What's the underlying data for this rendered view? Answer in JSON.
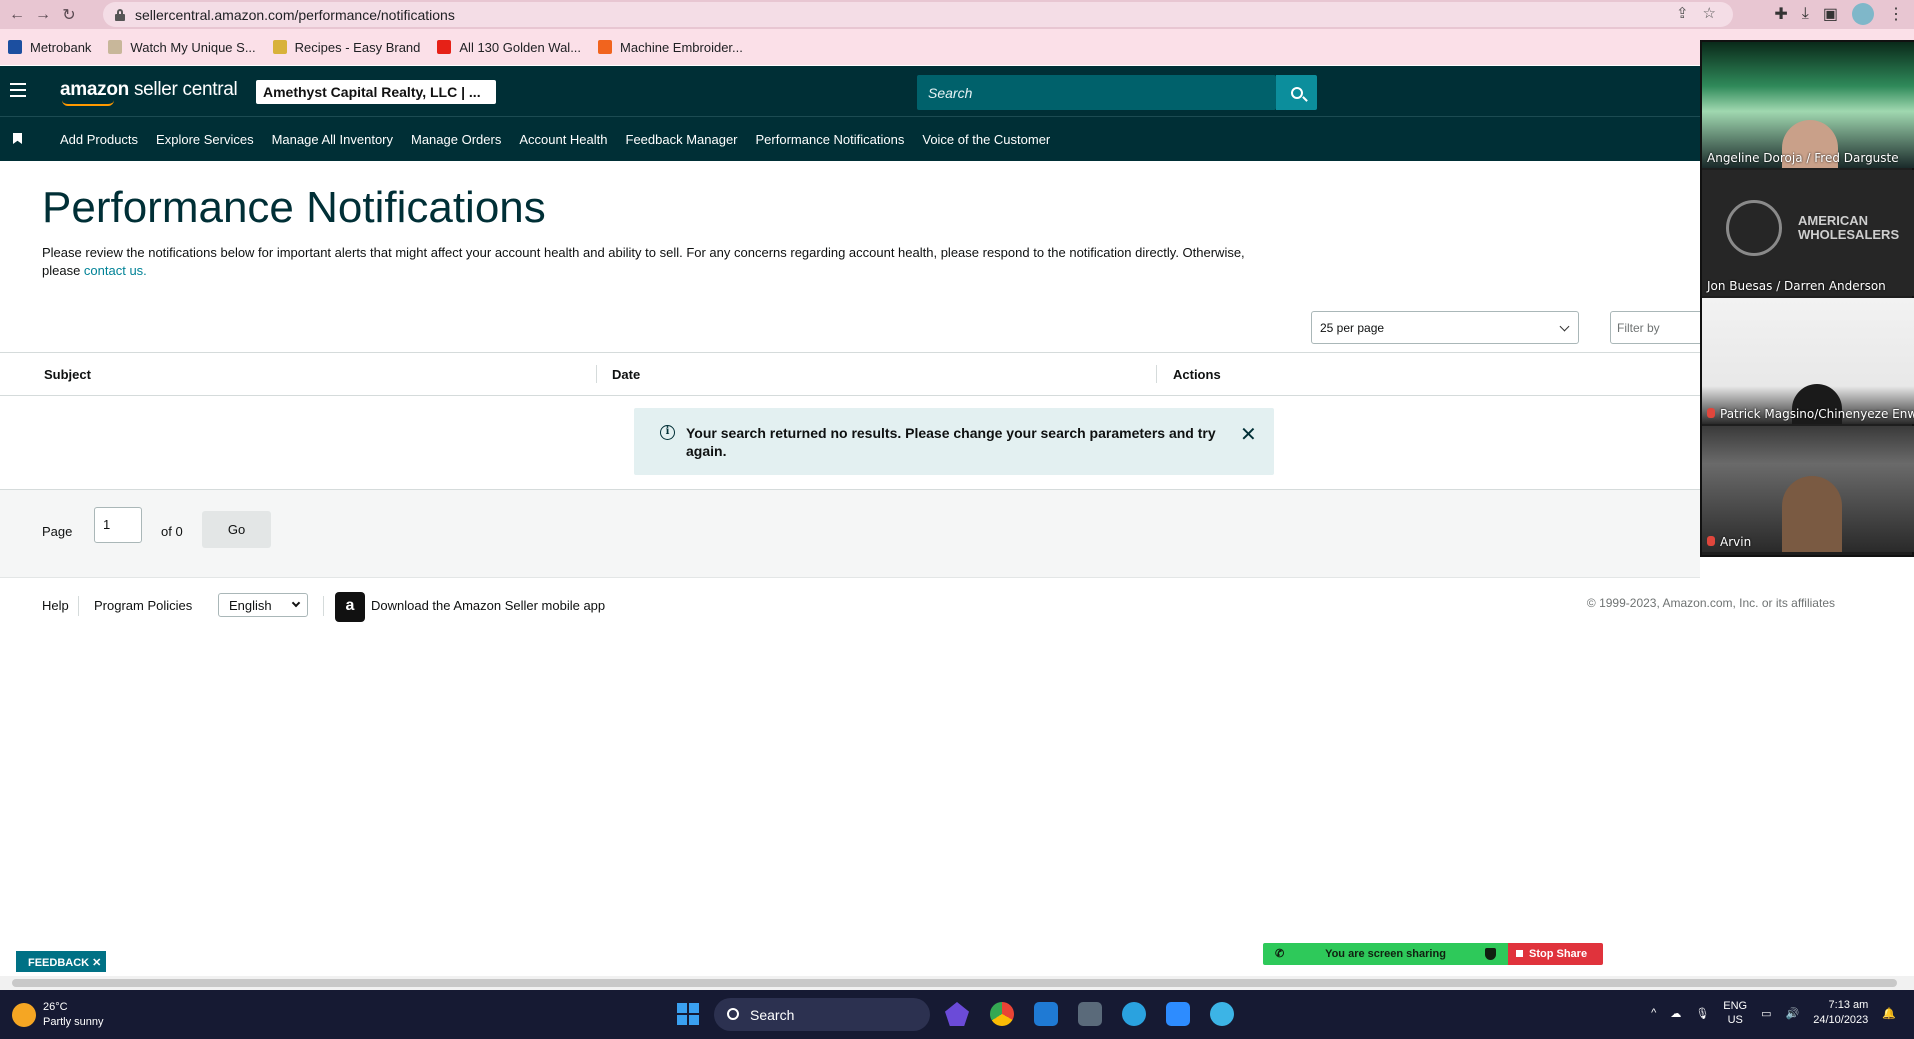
{
  "browser": {
    "url": "sellercentral.amazon.com/performance/notifications",
    "bookmarks": [
      {
        "label": "Metrobank",
        "color": "#1c4fa0"
      },
      {
        "label": "Watch My Unique S...",
        "color": "#c8b79a"
      },
      {
        "label": "Recipes - Easy Brand",
        "color": "#d8b23a"
      },
      {
        "label": "All 130 Golden Wal...",
        "color": "#e62117"
      },
      {
        "label": "Machine Embroider...",
        "color": "#f1641e"
      }
    ]
  },
  "header": {
    "logo_main": "amazon",
    "logo_sub": "seller central",
    "account": "Amethyst Capital Realty, LLC | ...",
    "search_placeholder": "Search"
  },
  "nav": {
    "items": [
      "Add Products",
      "Explore Services",
      "Manage All Inventory",
      "Manage Orders",
      "Account Health",
      "Feedback Manager",
      "Performance Notifications",
      "Voice of the Customer"
    ]
  },
  "main": {
    "title": "Performance Notifications",
    "description": "Please review the notifications below for important alerts that might affect your account health and ability to sell. For any concerns regarding account health, please respond to the notification directly. Otherwise, please ",
    "contact_link": "contact us.",
    "per_page": "25 per page",
    "filter_placeholder": "Filter by",
    "columns": [
      "Subject",
      "Date",
      "Actions"
    ],
    "alert_message": "Your search returned no results. Please change your search parameters and try again.",
    "pager": {
      "page_label": "Page",
      "page_value": "1",
      "of_label": "of 0",
      "go_label": "Go"
    }
  },
  "footer": {
    "help": "Help",
    "policies": "Program Policies",
    "language": "English",
    "app_link": "Download the Amazon Seller mobile app",
    "copyright": "© 1999-2023, Amazon.com, Inc. or its affiliates"
  },
  "video": {
    "tiles": [
      {
        "name": "Angeline Doroja / Fred Darguste",
        "muted": false
      },
      {
        "name": "Jon Buesas / Darren Anderson",
        "muted": false
      },
      {
        "name": "Patrick Magsino/Chinenyeze Enw",
        "muted": true
      },
      {
        "name": "Arvin",
        "muted": true
      }
    ],
    "tile_logo": "AMERICAN WHOLESALERS"
  },
  "feedback": "FEEDBACK ✕",
  "sharing": {
    "status": "You are screen sharing",
    "stop": "Stop Share"
  },
  "taskbar": {
    "temp": "26°C",
    "weather": "Partly sunny",
    "search": "Search",
    "lang_top": "ENG",
    "lang_bottom": "US",
    "time": "7:13 am",
    "date": "24/10/2023"
  }
}
